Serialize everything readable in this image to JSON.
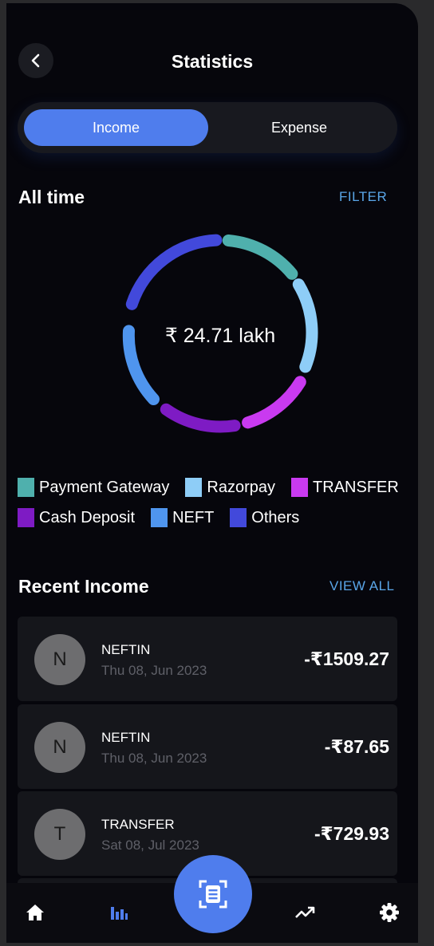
{
  "header": {
    "title": "Statistics",
    "back_icon": "chevron-left-icon"
  },
  "tabs": [
    {
      "label": "Income",
      "active": true
    },
    {
      "label": "Expense",
      "active": false
    }
  ],
  "overview": {
    "period_label": "All time",
    "filter_label": "FILTER",
    "total": "₹ 24.71 lakh"
  },
  "legend": [
    {
      "label": "Payment Gateway",
      "color": "#4fb0ad"
    },
    {
      "label": "Razorpay",
      "color": "#8ecdf7"
    },
    {
      "label": "TRANSFER",
      "color": "#c93af0"
    },
    {
      "label": "Cash Deposit",
      "color": "#7e1bc4"
    },
    {
      "label": "NEFT",
      "color": "#4f95ee"
    },
    {
      "label": "Others",
      "color": "#4249db"
    }
  ],
  "recent": {
    "title": "Recent Income",
    "view_all_label": "VIEW ALL",
    "items": [
      {
        "initial": "N",
        "name": "NEFTIN",
        "date": "Thu 08, Jun 2023",
        "amount": "-₹1509.27"
      },
      {
        "initial": "N",
        "name": "NEFTIN",
        "date": "Thu 08, Jun 2023",
        "amount": "-₹87.65"
      },
      {
        "initial": "T",
        "name": "TRANSFER",
        "date": "Sat 08, Jul 2023",
        "amount": "-₹729.93"
      }
    ]
  },
  "bottom_nav": {
    "items": [
      "home-icon",
      "statistics-icon",
      "scan-receipt-icon",
      "trending-up-icon",
      "settings-icon"
    ],
    "accent": "#4f7ded"
  }
}
